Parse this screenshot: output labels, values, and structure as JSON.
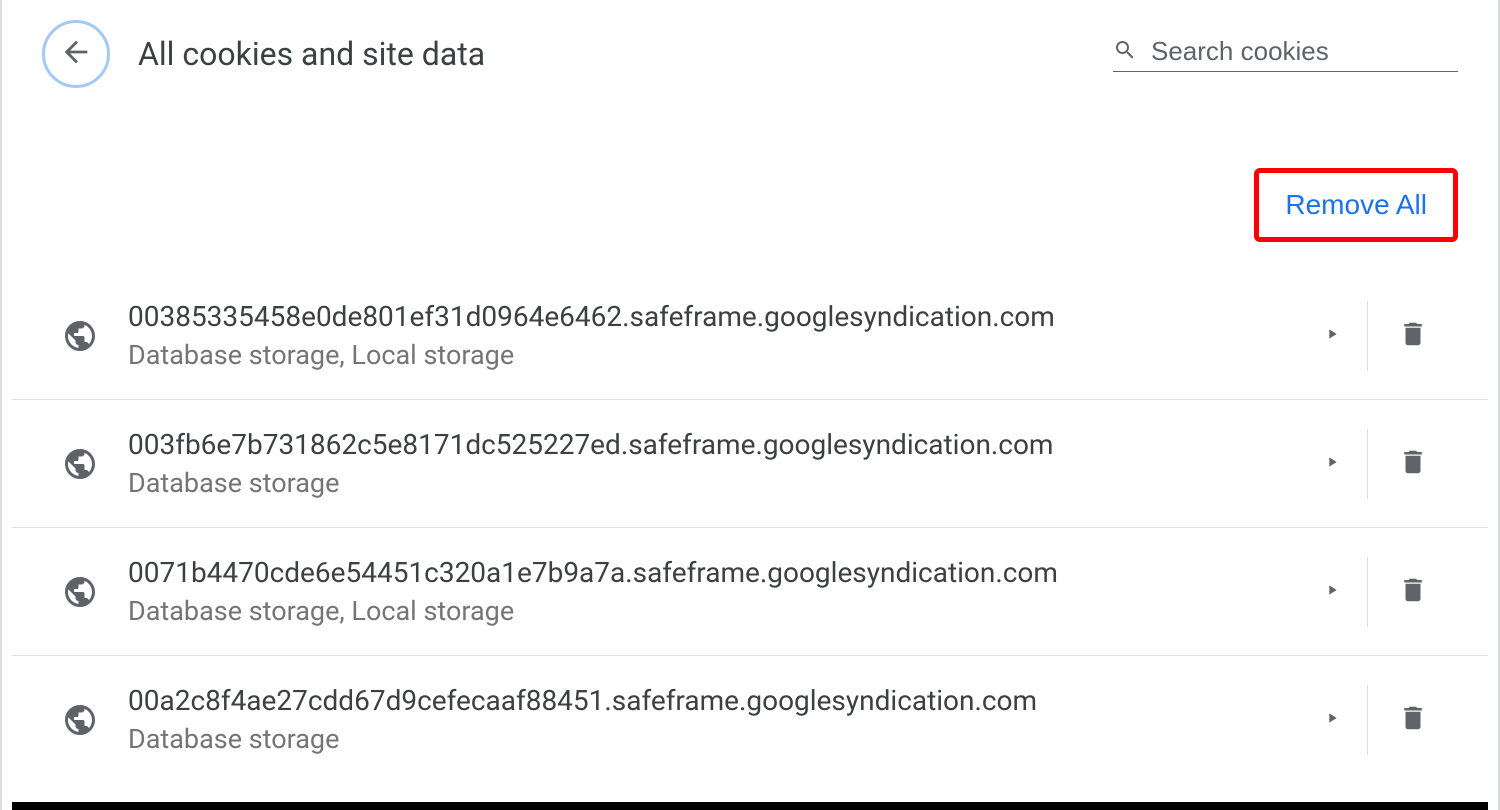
{
  "header": {
    "title": "All cookies and site data",
    "search_placeholder": "Search cookies"
  },
  "actions": {
    "remove_all_label": "Remove All"
  },
  "sites": [
    {
      "domain": "00385335458e0de801ef31d0964e6462.safeframe.googlesyndication.com",
      "storage": "Database storage, Local storage"
    },
    {
      "domain": "003fb6e7b731862c5e8171dc525227ed.safeframe.googlesyndication.com",
      "storage": "Database storage"
    },
    {
      "domain": "0071b4470cde6e54451c320a1e7b9a7a.safeframe.googlesyndication.com",
      "storage": "Database storage, Local storage"
    },
    {
      "domain": "00a2c8f4ae27cdd67d9cefecaaf88451.safeframe.googlesyndication.com",
      "storage": "Database storage"
    }
  ]
}
